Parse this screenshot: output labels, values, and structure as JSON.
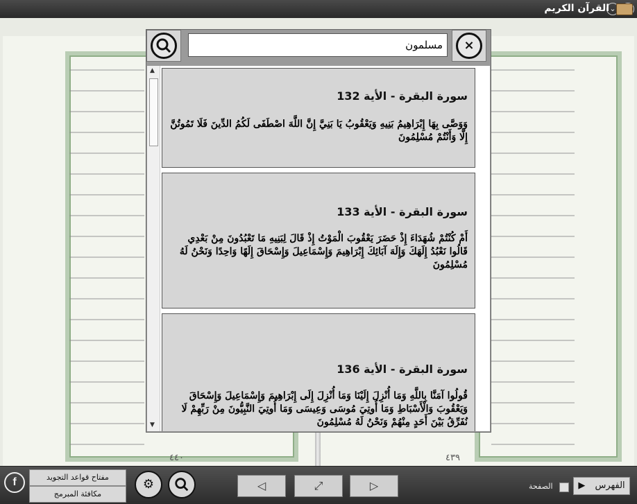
{
  "window": {
    "title": "القرآن الكريم",
    "min_icon": "chevron-down-icon",
    "close_icon": "close-icon"
  },
  "quran": {
    "left_page_number": "٤٤٠",
    "right_page_number": "٤٣٩"
  },
  "search": {
    "query": "مسلمون",
    "close_label": "×",
    "results": [
      {
        "heading": "سورة البقرة - الأية 132",
        "verse": "وَوَصَّى بِهَا إِبْرَاهِيمُ بَنِيهِ وَيَعْقُوبُ يَا بَنِيَّ إِنَّ اللَّهَ اصْطَفَى لَكُمُ الدِّينَ فَلَا تَمُوتُنَّ إِلَّا وَأَنْتُمْ مُسْلِمُونَ"
      },
      {
        "heading": "سورة البقرة - الأية 133",
        "verse": "أَمْ كُنْتُمْ شُهَدَاءَ إِذْ حَضَرَ يَعْقُوبَ الْمَوْتُ إِذْ قَالَ لِبَنِيهِ مَا تَعْبُدُونَ مِنْ بَعْدِي قَالُوا نَعْبُدُ إِلَهَكَ وَإِلَهَ آبَائِكَ إِبْرَاهِيمَ وَإِسْمَاعِيلَ وَإِسْحَاقَ إِلَهًا وَاحِدًا وَنَحْنُ لَهُ مُسْلِمُونَ"
      },
      {
        "heading": "سورة البقرة - الأية 136",
        "verse": "قُولُوا آمَنَّا بِاللَّهِ وَمَا أُنْزِلَ إِلَيْنَا وَمَا أُنْزِلَ إِلَى إِبْرَاهِيمَ وَإِسْمَاعِيلَ وَإِسْحَاقَ وَيَعْقُوبَ وَالْأَسْبَاطِ وَمَا أُوتِيَ مُوسَى وَعِيسَى وَمَا أُوتِيَ النَّبِيُّونَ مِنْ رَبِّهِمْ لَا نُفَرِّقُ بَيْنَ أَحَدٍ مِنْهُمْ وَنَحْنُ لَهُ مُسْلِمُونَ"
      }
    ]
  },
  "bottombar": {
    "tajweed_label": "مفتاح قواعد التجويد",
    "reward_label": "مكافئة المبرمج",
    "page_label": "الصفحة",
    "index_label": "الفهرس",
    "index_arrow": "▶",
    "prev_glyph": "◁",
    "expand_glyph": "⤢",
    "next_glyph": "▷",
    "fb_glyph": "f",
    "settings_glyph": "⚙"
  }
}
